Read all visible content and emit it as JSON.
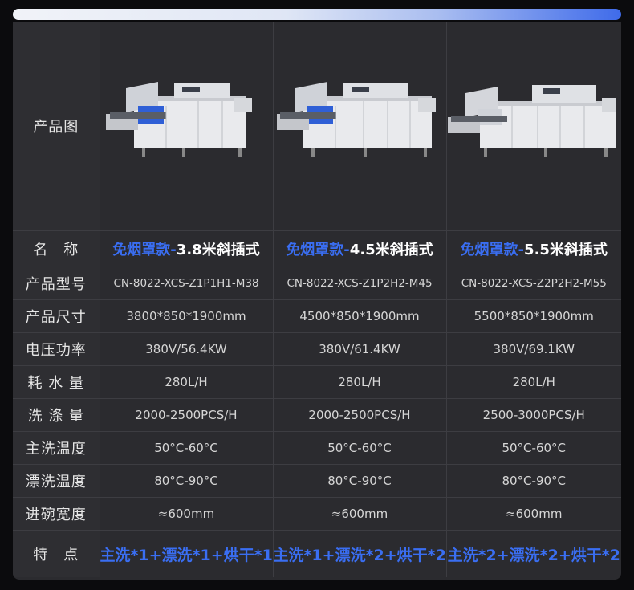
{
  "labels": {
    "image": "产品图",
    "name": "名　称",
    "model": "产品型号",
    "size": "产品尺寸",
    "power": "电压功率",
    "water": "耗 水 量",
    "capacity": "洗 涤 量",
    "main_temp": "主洗温度",
    "rinse_temp": "漂洗温度",
    "width": "进碗宽度",
    "feature": "特　点"
  },
  "products": [
    {
      "name_tag": "免烟罩款-",
      "name_rest": "3.8米斜插式",
      "model": "CN-8022-XCS-Z1P1H1-M38",
      "size": "3800*850*1900mm",
      "power": "380V/56.4KW",
      "water": "280L/H",
      "capacity": "2000-2500PCS/H",
      "main_temp": "50°C-60°C",
      "rinse_temp": "80°C-90°C",
      "width": "≈600mm",
      "feature": "主洗*1+漂洗*1+烘干*1"
    },
    {
      "name_tag": "免烟罩款-",
      "name_rest": "4.5米斜插式",
      "model": "CN-8022-XCS-Z1P2H2-M45",
      "size": "4500*850*1900mm",
      "power": "380V/61.4KW",
      "water": "280L/H",
      "capacity": "2000-2500PCS/H",
      "main_temp": "50°C-60°C",
      "rinse_temp": "80°C-90°C",
      "width": "≈600mm",
      "feature": "主洗*1+漂洗*2+烘干*2"
    },
    {
      "name_tag": "免烟罩款-",
      "name_rest": "5.5米斜插式",
      "model": "CN-8022-XCS-Z2P2H2-M55",
      "size": "5500*850*1900mm",
      "power": "380V/69.1KW",
      "water": "280L/H",
      "capacity": "2500-3000PCS/H",
      "main_temp": "50°C-60°C",
      "rinse_temp": "80°C-90°C",
      "width": "≈600mm",
      "feature": "主洗*2+漂洗*2+烘干*2"
    }
  ],
  "colors": {
    "accent_blue": "#3a6ef2",
    "panel_bg": "#2b2b2f"
  }
}
